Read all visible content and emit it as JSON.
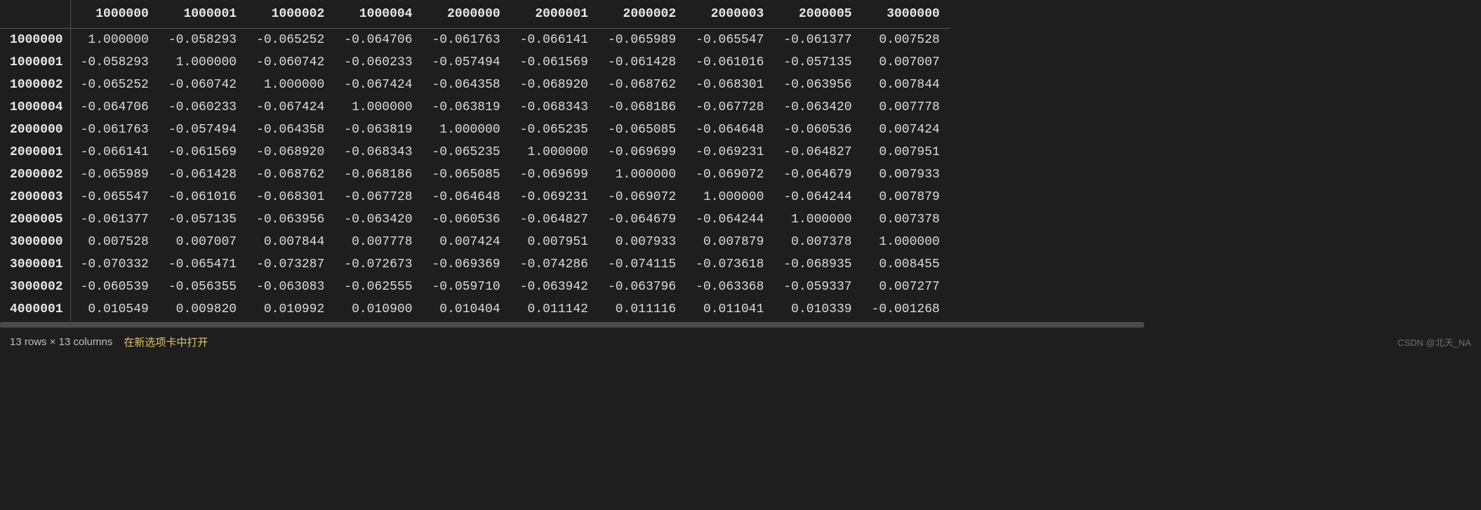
{
  "table": {
    "columns": [
      "1000000",
      "1000001",
      "1000002",
      "1000004",
      "2000000",
      "2000001",
      "2000002",
      "2000003",
      "2000005",
      "3000000"
    ],
    "index": [
      "1000000",
      "1000001",
      "1000002",
      "1000004",
      "2000000",
      "2000001",
      "2000002",
      "2000003",
      "2000005",
      "3000000",
      "3000001",
      "3000002",
      "4000001"
    ],
    "rows": [
      [
        "1.000000",
        "-0.058293",
        "-0.065252",
        "-0.064706",
        "-0.061763",
        "-0.066141",
        "-0.065989",
        "-0.065547",
        "-0.061377",
        "0.007528"
      ],
      [
        "-0.058293",
        "1.000000",
        "-0.060742",
        "-0.060233",
        "-0.057494",
        "-0.061569",
        "-0.061428",
        "-0.061016",
        "-0.057135",
        "0.007007"
      ],
      [
        "-0.065252",
        "-0.060742",
        "1.000000",
        "-0.067424",
        "-0.064358",
        "-0.068920",
        "-0.068762",
        "-0.068301",
        "-0.063956",
        "0.007844"
      ],
      [
        "-0.064706",
        "-0.060233",
        "-0.067424",
        "1.000000",
        "-0.063819",
        "-0.068343",
        "-0.068186",
        "-0.067728",
        "-0.063420",
        "0.007778"
      ],
      [
        "-0.061763",
        "-0.057494",
        "-0.064358",
        "-0.063819",
        "1.000000",
        "-0.065235",
        "-0.065085",
        "-0.064648",
        "-0.060536",
        "0.007424"
      ],
      [
        "-0.066141",
        "-0.061569",
        "-0.068920",
        "-0.068343",
        "-0.065235",
        "1.000000",
        "-0.069699",
        "-0.069231",
        "-0.064827",
        "0.007951"
      ],
      [
        "-0.065989",
        "-0.061428",
        "-0.068762",
        "-0.068186",
        "-0.065085",
        "-0.069699",
        "1.000000",
        "-0.069072",
        "-0.064679",
        "0.007933"
      ],
      [
        "-0.065547",
        "-0.061016",
        "-0.068301",
        "-0.067728",
        "-0.064648",
        "-0.069231",
        "-0.069072",
        "1.000000",
        "-0.064244",
        "0.007879"
      ],
      [
        "-0.061377",
        "-0.057135",
        "-0.063956",
        "-0.063420",
        "-0.060536",
        "-0.064827",
        "-0.064679",
        "-0.064244",
        "1.000000",
        "0.007378"
      ],
      [
        "0.007528",
        "0.007007",
        "0.007844",
        "0.007778",
        "0.007424",
        "0.007951",
        "0.007933",
        "0.007879",
        "0.007378",
        "1.000000"
      ],
      [
        "-0.070332",
        "-0.065471",
        "-0.073287",
        "-0.072673",
        "-0.069369",
        "-0.074286",
        "-0.074115",
        "-0.073618",
        "-0.068935",
        "0.008455"
      ],
      [
        "-0.060539",
        "-0.056355",
        "-0.063083",
        "-0.062555",
        "-0.059710",
        "-0.063942",
        "-0.063796",
        "-0.063368",
        "-0.059337",
        "0.007277"
      ],
      [
        "0.010549",
        "0.009820",
        "0.010992",
        "0.010900",
        "0.010404",
        "0.011142",
        "0.011116",
        "0.011041",
        "0.010339",
        "-0.001268"
      ]
    ]
  },
  "footer": {
    "summary": "13 rows × 13 columns",
    "open_new_tab": "在新选项卡中打开",
    "watermark": "CSDN @北天_NA"
  }
}
